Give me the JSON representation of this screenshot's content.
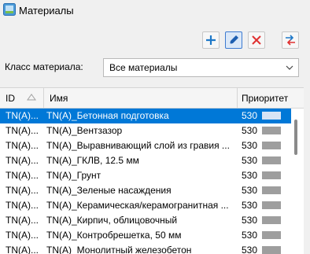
{
  "window": {
    "title": "Материалы",
    "icon": "materials-app-icon"
  },
  "toolbar": {
    "buttons": [
      {
        "name": "add-button",
        "icon": "plus-icon",
        "color": "#1e78c8"
      },
      {
        "name": "edit-button",
        "icon": "pencil-icon",
        "color": "#1e5fb0",
        "active": true
      },
      {
        "name": "delete-button",
        "icon": "close-icon",
        "color": "#e03030"
      },
      {
        "name": "transfer-button",
        "icon": "swap-arrows-icon",
        "color": "#1e78c8"
      }
    ]
  },
  "filter": {
    "label": "Класс материала:",
    "value": "Все материалы"
  },
  "table": {
    "columns": [
      {
        "key": "id",
        "label": "ID"
      },
      {
        "key": "name",
        "label": "Имя"
      },
      {
        "key": "priority",
        "label": "Приоритет"
      }
    ],
    "rows": [
      {
        "id": "TN(A)...",
        "name": "TN(A)_Бетонная подготовка",
        "priority": "530",
        "selected": true
      },
      {
        "id": "TN(A)...",
        "name": "TN(A)_Вентзазор",
        "priority": "530"
      },
      {
        "id": "TN(A)...",
        "name": "TN(A)_Выравнивающий слой из гравия ...",
        "priority": "530"
      },
      {
        "id": "TN(A)...",
        "name": "TN(A)_ГКЛВ, 12.5 мм",
        "priority": "530"
      },
      {
        "id": "TN(A)...",
        "name": "TN(A)_Грунт",
        "priority": "530"
      },
      {
        "id": "TN(A)...",
        "name": "TN(A)_Зеленые насаждения",
        "priority": "530"
      },
      {
        "id": "TN(A)...",
        "name": "TN(A)_Керамическая/керамогранитная ...",
        "priority": "530"
      },
      {
        "id": "TN(A)...",
        "name": "TN(A)_Кирпич, облицовочный",
        "priority": "530"
      },
      {
        "id": "TN(A)...",
        "name": "TN(A)_Контробрешетка, 50 мм",
        "priority": "530"
      },
      {
        "id": "TN(A)...",
        "name": "TN(A)_Монолитный железобетон",
        "priority": "530"
      }
    ]
  },
  "colors": {
    "selection": "#0078d7",
    "priority_bar": "#9e9e9e"
  }
}
